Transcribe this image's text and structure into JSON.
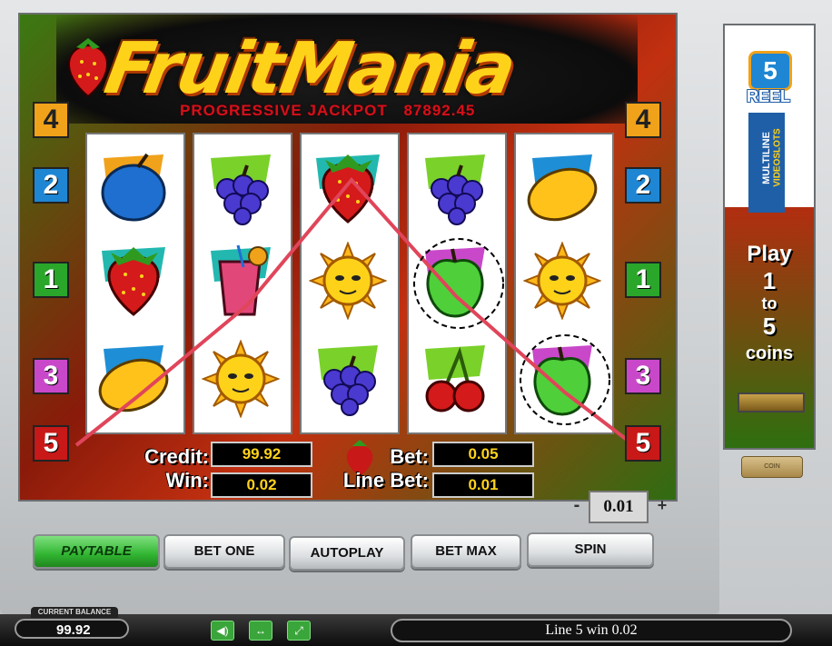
{
  "game": {
    "logo_text": "FruitMania",
    "jackpot_label": "PROGRESSIVE JACKPOT",
    "jackpot_value": "87892.45"
  },
  "paylines": {
    "left": [
      "4",
      "2",
      "1",
      "3",
      "5"
    ],
    "right": [
      "4",
      "2",
      "1",
      "3",
      "5"
    ]
  },
  "reels": [
    [
      "plum",
      "strawberry",
      "lemon"
    ],
    [
      "grapes",
      "juice",
      "sun"
    ],
    [
      "strawberry",
      "sun",
      "grapes"
    ],
    [
      "grapes",
      "apple",
      "cherry"
    ],
    [
      "lemon",
      "sun",
      "apple"
    ]
  ],
  "winning_symbols": [
    "reel4-row2-apple",
    "reel5-row3-apple"
  ],
  "info": {
    "credit_label": "Credit:",
    "credit_value": "99.92",
    "win_label": "Win:",
    "win_value": "0.02",
    "bet_label": "Bet:",
    "bet_value": "0.05",
    "line_bet_label": "Line Bet:",
    "line_bet_value": "0.01"
  },
  "coin_selector": {
    "minus": "-",
    "value": "0.01",
    "plus": "+"
  },
  "buttons": {
    "paytable": "PAYTABLE",
    "bet_one": "BET ONE",
    "autoplay": "AUTOPLAY",
    "bet_max": "BET MAX",
    "spin": "SPIN"
  },
  "side_banner": {
    "reel_count": "5",
    "reel_label": "REEL",
    "multiline": "MULTILINE",
    "videoslots": "VIDEOSLOTS",
    "play_text": "Play",
    "one": "1",
    "to": "to",
    "five": "5",
    "coins": "coins",
    "coin_slot_label": "COIN"
  },
  "status_bar": {
    "balance_label": "CURRENT BALANCE",
    "balance_value": "99.92",
    "message": "Line 5 win  0.02"
  },
  "icons": [
    "sound-icon",
    "arrows-icon",
    "fullscreen-icon"
  ],
  "colors": {
    "jackpot_red": "#d6101b",
    "value_yellow": "#ffd21a",
    "payline_red": "#e0455a"
  }
}
